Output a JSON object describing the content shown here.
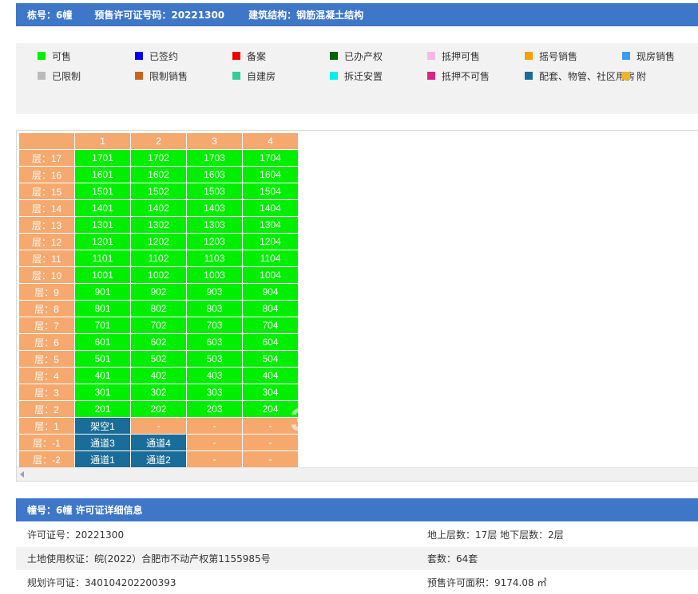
{
  "header": {
    "building_no": "栋号：6幢",
    "permit_no": "预售许可证号码：20221300",
    "structure": "建筑结构：钢筋混凝土结构"
  },
  "legend": [
    {
      "label": "可售",
      "color": "#00ee00",
      "icon": "status-swatch"
    },
    {
      "label": "已签约",
      "color": "#0000ee",
      "icon": "status-swatch"
    },
    {
      "label": "备案",
      "color": "#ee0000",
      "icon": "status-swatch"
    },
    {
      "label": "已办产权",
      "color": "#006400",
      "icon": "status-swatch"
    },
    {
      "label": "抵押可售",
      "color": "#ffb6e1",
      "icon": "status-swatch"
    },
    {
      "label": "摇号销售",
      "color": "#f5a000",
      "icon": "status-swatch"
    },
    {
      "label": "现房销售",
      "color": "#3a9cf0",
      "icon": "status-swatch"
    },
    {
      "label": "已限制",
      "color": "#bbbbbb",
      "icon": "status-swatch"
    },
    {
      "label": "限制销售",
      "color": "#c8641e",
      "icon": "status-swatch"
    },
    {
      "label": "自建房",
      "color": "#33cc99",
      "icon": "status-swatch"
    },
    {
      "label": "拆迁安置",
      "color": "#00eeee",
      "icon": "status-swatch"
    },
    {
      "label": "抵押不可售",
      "color": "#d62585",
      "icon": "status-swatch"
    },
    {
      "label": "配套、物管、社区用房",
      "color": "#1a6d98",
      "icon": "status-swatch"
    },
    {
      "label": "附",
      "color": "#f0b428",
      "icon": "status-swatch"
    }
  ],
  "grid": {
    "columns": [
      "",
      "1",
      "2",
      "3",
      "4"
    ],
    "watermark": "3",
    "rows": [
      {
        "floor": "层：17",
        "cells": [
          {
            "t": "1701",
            "s": "sale"
          },
          {
            "t": "1702",
            "s": "sale"
          },
          {
            "t": "1703",
            "s": "sale"
          },
          {
            "t": "1704",
            "s": "sale"
          }
        ]
      },
      {
        "floor": "层：16",
        "cells": [
          {
            "t": "1601",
            "s": "sale"
          },
          {
            "t": "1602",
            "s": "sale"
          },
          {
            "t": "1603",
            "s": "sale"
          },
          {
            "t": "1604",
            "s": "sale"
          }
        ]
      },
      {
        "floor": "层：15",
        "cells": [
          {
            "t": "1501",
            "s": "sale"
          },
          {
            "t": "1502",
            "s": "sale"
          },
          {
            "t": "1503",
            "s": "sale"
          },
          {
            "t": "1504",
            "s": "sale"
          }
        ]
      },
      {
        "floor": "层：14",
        "cells": [
          {
            "t": "1401",
            "s": "sale"
          },
          {
            "t": "1402",
            "s": "sale"
          },
          {
            "t": "1403",
            "s": "sale"
          },
          {
            "t": "1404",
            "s": "sale"
          }
        ]
      },
      {
        "floor": "层：13",
        "cells": [
          {
            "t": "1301",
            "s": "sale"
          },
          {
            "t": "1302",
            "s": "sale"
          },
          {
            "t": "1303",
            "s": "sale"
          },
          {
            "t": "1304",
            "s": "sale"
          }
        ]
      },
      {
        "floor": "层：12",
        "cells": [
          {
            "t": "1201",
            "s": "sale"
          },
          {
            "t": "1202",
            "s": "sale"
          },
          {
            "t": "1203",
            "s": "sale"
          },
          {
            "t": "1204",
            "s": "sale"
          }
        ]
      },
      {
        "floor": "层：11",
        "cells": [
          {
            "t": "1101",
            "s": "sale"
          },
          {
            "t": "1102",
            "s": "sale"
          },
          {
            "t": "1103",
            "s": "sale"
          },
          {
            "t": "1104",
            "s": "sale"
          }
        ]
      },
      {
        "floor": "层：10",
        "cells": [
          {
            "t": "1001",
            "s": "sale"
          },
          {
            "t": "1002",
            "s": "sale"
          },
          {
            "t": "1003",
            "s": "sale"
          },
          {
            "t": "1004",
            "s": "sale"
          }
        ]
      },
      {
        "floor": "层：9",
        "cells": [
          {
            "t": "901",
            "s": "sale"
          },
          {
            "t": "902",
            "s": "sale"
          },
          {
            "t": "903",
            "s": "sale"
          },
          {
            "t": "904",
            "s": "sale"
          }
        ]
      },
      {
        "floor": "层：8",
        "cells": [
          {
            "t": "801",
            "s": "sale"
          },
          {
            "t": "802",
            "s": "sale"
          },
          {
            "t": "803",
            "s": "sale"
          },
          {
            "t": "804",
            "s": "sale"
          }
        ]
      },
      {
        "floor": "层：7",
        "cells": [
          {
            "t": "701",
            "s": "sale"
          },
          {
            "t": "702",
            "s": "sale"
          },
          {
            "t": "703",
            "s": "sale"
          },
          {
            "t": "704",
            "s": "sale"
          }
        ]
      },
      {
        "floor": "层：6",
        "cells": [
          {
            "t": "601",
            "s": "sale"
          },
          {
            "t": "602",
            "s": "sale"
          },
          {
            "t": "603",
            "s": "sale"
          },
          {
            "t": "604",
            "s": "sale"
          }
        ]
      },
      {
        "floor": "层：5",
        "cells": [
          {
            "t": "501",
            "s": "sale"
          },
          {
            "t": "502",
            "s": "sale"
          },
          {
            "t": "503",
            "s": "sale"
          },
          {
            "t": "504",
            "s": "sale"
          }
        ]
      },
      {
        "floor": "层：4",
        "cells": [
          {
            "t": "401",
            "s": "sale"
          },
          {
            "t": "402",
            "s": "sale"
          },
          {
            "t": "403",
            "s": "sale"
          },
          {
            "t": "404",
            "s": "sale"
          }
        ]
      },
      {
        "floor": "层：3",
        "cells": [
          {
            "t": "301",
            "s": "sale"
          },
          {
            "t": "302",
            "s": "sale"
          },
          {
            "t": "303",
            "s": "sale"
          },
          {
            "t": "304",
            "s": "sale"
          }
        ]
      },
      {
        "floor": "层：2",
        "cells": [
          {
            "t": "201",
            "s": "sale"
          },
          {
            "t": "202",
            "s": "sale"
          },
          {
            "t": "203",
            "s": "sale"
          },
          {
            "t": "204",
            "s": "sale"
          }
        ]
      },
      {
        "floor": "层：1",
        "cells": [
          {
            "t": "架空1",
            "s": "blue"
          },
          {
            "t": "-",
            "s": "empty"
          },
          {
            "t": "-",
            "s": "empty"
          },
          {
            "t": "-",
            "s": "empty"
          }
        ]
      },
      {
        "floor": "层：-1",
        "cells": [
          {
            "t": "通道3",
            "s": "blue"
          },
          {
            "t": "通道4",
            "s": "blue"
          },
          {
            "t": "-",
            "s": "empty"
          },
          {
            "t": "-",
            "s": "empty"
          }
        ]
      },
      {
        "floor": "层：-2",
        "cells": [
          {
            "t": "通道1",
            "s": "blue"
          },
          {
            "t": "通道2",
            "s": "blue"
          },
          {
            "t": "-",
            "s": "empty"
          },
          {
            "t": "-",
            "s": "empty"
          }
        ]
      }
    ]
  },
  "detail": {
    "title": "幢号：6幢 许可证详细信息",
    "rows": [
      {
        "left": "许可证号：20221300",
        "right": "地上层数：17层  地下层数：2层"
      },
      {
        "left": "土地使用权证：皖(2022）合肥市不动产权第1155985号",
        "right": "套数：64套"
      },
      {
        "left": "规划许可证：340104202200393",
        "right": "预售许可面积：9174.08 ㎡"
      }
    ]
  }
}
